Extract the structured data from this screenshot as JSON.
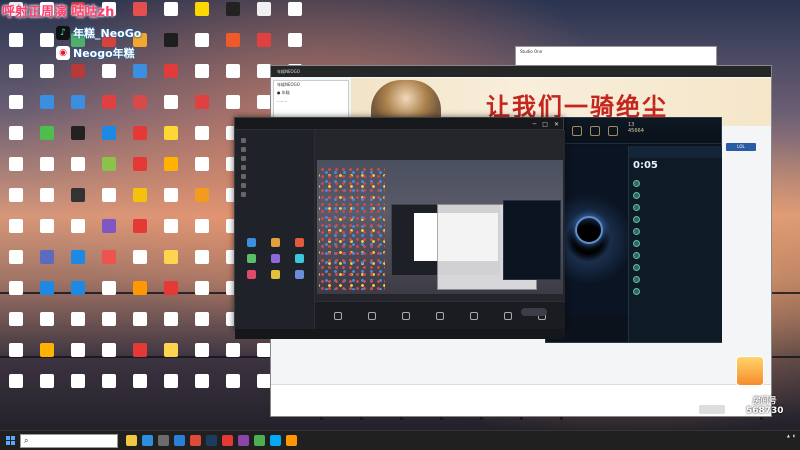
{
  "overlay": {
    "title": "呼射正周演",
    "title_suffix": "咕咕zh",
    "socials": [
      {
        "platform": "douyin",
        "icon": "tiktok-icon",
        "text": "年糕_NeoGo",
        "color": "#111111"
      },
      {
        "platform": "weibo",
        "icon": "weibo-icon",
        "text": "Neogo年糕",
        "color": "#e6162d"
      }
    ]
  },
  "desktop_icons": [
    {
      "label": "",
      "color": "#e8e8e8"
    },
    {
      "label": "",
      "color": "#ffffff"
    },
    {
      "label": "",
      "color": "#c23a3a"
    },
    {
      "label": "",
      "color": "#ffffff"
    },
    {
      "label": "",
      "color": "#e34f4f"
    },
    {
      "label": "",
      "color": "#ffffff"
    },
    {
      "label": "",
      "color": "#ffd700"
    },
    {
      "label": "",
      "color": "#222222"
    },
    {
      "label": "",
      "color": "#f0f0f0"
    },
    {
      "label": "",
      "color": "#ffffff"
    },
    {
      "label": "",
      "color": "#ffffff"
    },
    {
      "label": "",
      "color": "#ffffff"
    },
    {
      "label": "",
      "color": "#4fb06a"
    },
    {
      "label": "",
      "color": "#d9413a"
    },
    {
      "label": "",
      "color": "#f2a72e"
    },
    {
      "label": "",
      "color": "#1e1e1e"
    },
    {
      "label": "",
      "color": "#ffffff"
    },
    {
      "label": "",
      "color": "#f05a28"
    },
    {
      "label": "",
      "color": "#e04040"
    },
    {
      "label": "",
      "color": "#ffffff"
    },
    {
      "label": "",
      "color": "#ffffff"
    },
    {
      "label": "",
      "color": "#ffffff"
    },
    {
      "label": "",
      "color": "#b53a3a"
    },
    {
      "label": "",
      "color": "#ffffff"
    },
    {
      "label": "",
      "color": "#3a8fe0"
    },
    {
      "label": "",
      "color": "#e23b3b"
    },
    {
      "label": "",
      "color": "#ffffff"
    },
    {
      "label": "",
      "color": "#ffffff"
    },
    {
      "label": "",
      "color": "#ffffff"
    },
    {
      "label": "",
      "color": "#ffffff"
    },
    {
      "label": "",
      "color": "#ffffff"
    },
    {
      "label": "",
      "color": "#3a8fe0"
    },
    {
      "label": "",
      "color": "#3a8fe0"
    },
    {
      "label": "",
      "color": "#e04040"
    },
    {
      "label": "",
      "color": "#d64a4a"
    },
    {
      "label": "",
      "color": "#ffffff"
    },
    {
      "label": "",
      "color": "#e04040"
    },
    {
      "label": "",
      "color": "#ffffff"
    },
    {
      "label": "",
      "color": "#ffffff"
    },
    {
      "label": "",
      "color": "#ffffff"
    },
    {
      "label": "",
      "color": "#ffffff"
    },
    {
      "label": "",
      "color": "#4dbe4d"
    },
    {
      "label": "",
      "color": "#222222"
    },
    {
      "label": "",
      "color": "#1e88e5"
    },
    {
      "label": "",
      "color": "#e53935"
    },
    {
      "label": "",
      "color": "#fdd835"
    },
    {
      "label": "",
      "color": "#ffffff"
    },
    {
      "label": "",
      "color": "#ffffff"
    },
    {
      "label": "",
      "color": "#ffffff"
    },
    {
      "label": "",
      "color": "#ffffff"
    },
    {
      "label": "",
      "color": "#ffffff"
    },
    {
      "label": "",
      "color": "#ffffff"
    },
    {
      "label": "",
      "color": "#ffffff"
    },
    {
      "label": "",
      "color": "#8bc34a"
    },
    {
      "label": "",
      "color": "#e53935"
    },
    {
      "label": "",
      "color": "#ffb300"
    },
    {
      "label": "",
      "color": "#ffffff"
    },
    {
      "label": "",
      "color": "#ffffff"
    },
    {
      "label": "",
      "color": "#ffffff"
    },
    {
      "label": "",
      "color": "#ffffff"
    },
    {
      "label": "",
      "color": "#ffffff"
    },
    {
      "label": "",
      "color": "#ffffff"
    },
    {
      "label": "",
      "color": "#333333"
    },
    {
      "label": "",
      "color": "#ffffff"
    },
    {
      "label": "",
      "color": "#f4c20d"
    },
    {
      "label": "",
      "color": "#ffffff"
    },
    {
      "label": "",
      "color": "#f29b1e"
    },
    {
      "label": "",
      "color": "#ffffff"
    },
    {
      "label": "",
      "color": "#ffffff"
    },
    {
      "label": "",
      "color": "#ffffff"
    },
    {
      "label": "",
      "color": "#ffffff"
    },
    {
      "label": "",
      "color": "#ffffff"
    },
    {
      "label": "",
      "color": "#ffffff"
    },
    {
      "label": "",
      "color": "#7e57c2"
    },
    {
      "label": "",
      "color": "#e53935"
    },
    {
      "label": "",
      "color": "#ffffff"
    },
    {
      "label": "",
      "color": "#ffffff"
    },
    {
      "label": "",
      "color": "#ffffff"
    },
    {
      "label": "",
      "color": "#ffffff"
    },
    {
      "label": "",
      "color": "#ffffff"
    },
    {
      "label": "",
      "color": "#ffffff"
    },
    {
      "label": "",
      "color": "#5c6bc0"
    },
    {
      "label": "",
      "color": "#1e88e5"
    },
    {
      "label": "",
      "color": "#ef5350"
    },
    {
      "label": "",
      "color": "#ffffff"
    },
    {
      "label": "",
      "color": "#ffd54f"
    },
    {
      "label": "",
      "color": "#ffffff"
    },
    {
      "label": "",
      "color": "#ffffff"
    },
    {
      "label": "",
      "color": "#ffffff"
    },
    {
      "label": "",
      "color": "#ffffff"
    },
    {
      "label": "",
      "color": "#ffffff"
    },
    {
      "label": "",
      "color": "#1e88e5"
    },
    {
      "label": "",
      "color": "#1e88e5"
    },
    {
      "label": "",
      "color": "#ffffff"
    },
    {
      "label": "",
      "color": "#ff9800"
    },
    {
      "label": "",
      "color": "#e53935"
    },
    {
      "label": "",
      "color": "#ffffff"
    },
    {
      "label": "",
      "color": "#ffffff"
    },
    {
      "label": "",
      "color": "#ffffff"
    },
    {
      "label": "",
      "color": "#ffffff"
    },
    {
      "label": "",
      "color": "#ffffff"
    },
    {
      "label": "",
      "color": "#ffffff"
    },
    {
      "label": "",
      "color": "#ffffff"
    },
    {
      "label": "",
      "color": "#ffffff"
    },
    {
      "label": "",
      "color": "#ffffff"
    },
    {
      "label": "",
      "color": "#ffffff"
    },
    {
      "label": "",
      "color": "#ffffff"
    },
    {
      "label": "",
      "color": "#ffffff"
    },
    {
      "label": "",
      "color": "#ffffff"
    },
    {
      "label": "",
      "color": "#ffffff"
    },
    {
      "label": "",
      "color": "#ffffff"
    },
    {
      "label": "",
      "color": "#ffb300"
    },
    {
      "label": "",
      "color": "#ffffff"
    },
    {
      "label": "",
      "color": "#ffffff"
    },
    {
      "label": "",
      "color": "#e53935"
    },
    {
      "label": "",
      "color": "#ffd54f"
    },
    {
      "label": "",
      "color": "#ffffff"
    },
    {
      "label": "",
      "color": "#ffffff"
    },
    {
      "label": "",
      "color": "#ffffff"
    },
    {
      "label": "",
      "color": "#ffffff"
    },
    {
      "label": "",
      "color": "#ffffff"
    },
    {
      "label": "",
      "color": "#ffffff"
    },
    {
      "label": "",
      "color": "#ffffff"
    },
    {
      "label": "",
      "color": "#ffffff"
    },
    {
      "label": "",
      "color": "#ffffff"
    },
    {
      "label": "",
      "color": "#ffffff"
    },
    {
      "label": "",
      "color": "#ffffff"
    },
    {
      "label": "",
      "color": "#ffffff"
    },
    {
      "label": "",
      "color": "#ffffff"
    },
    {
      "label": "",
      "color": "#ffffff"
    }
  ],
  "browser": {
    "banner_text": "让我们一骑绝尘",
    "left_rows": [
      "年糕NEOGO",
      "● 年糕",
      "........"
    ],
    "chat_notice": "",
    "chat_tools": [
      "",
      "",
      "",
      ""
    ],
    "send": "",
    "gift": ""
  },
  "small_window": {
    "title": "Studio One",
    "menu": [
      "",
      "",
      "",
      "",
      ""
    ]
  },
  "game": {
    "level_name": "13",
    "level_num": "45664",
    "timer": "0:05",
    "friends_header": "",
    "friends": [
      "",
      "",
      "",
      "",
      "",
      "",
      "",
      "",
      "",
      ""
    ],
    "lol_button": "LOL"
  },
  "studio": {
    "logo_a": "",
    "logo_b": "",
    "section_title": "",
    "scene_rows": [
      "",
      "",
      "",
      "",
      "",
      "",
      ""
    ],
    "tools_title": "",
    "tools": [
      "",
      "",
      "",
      "",
      "",
      "",
      "",
      "",
      ""
    ],
    "tabs": [
      "",
      "",
      ""
    ],
    "bottom_buttons": [
      "",
      "",
      "",
      "",
      "",
      "",
      ""
    ],
    "go_live": "",
    "statusline": ""
  },
  "taskbar": {
    "search_placeholder": "",
    "apps": [
      {
        "icon": "folder-icon",
        "color": "#f2c744"
      },
      {
        "icon": "edge-icon",
        "color": "#2b8fde"
      },
      {
        "icon": "store-icon",
        "color": "#6c6c6c"
      },
      {
        "icon": "mail-icon",
        "color": "#2b7fd9"
      },
      {
        "icon": "chrome-icon",
        "color": "#e04a39"
      },
      {
        "icon": "game-icon",
        "color": "#1e3b60"
      },
      {
        "icon": "record-icon",
        "color": "#e53935"
      },
      {
        "icon": "app-icon",
        "color": "#8e44ad"
      },
      {
        "icon": "app-icon",
        "color": "#4caf50"
      },
      {
        "icon": "app-icon",
        "color": "#03a9f4"
      },
      {
        "icon": "app-icon",
        "color": "#ff9800"
      }
    ],
    "time": "",
    "date": ""
  },
  "viewers": {
    "label": "房间号",
    "number": "568730"
  }
}
